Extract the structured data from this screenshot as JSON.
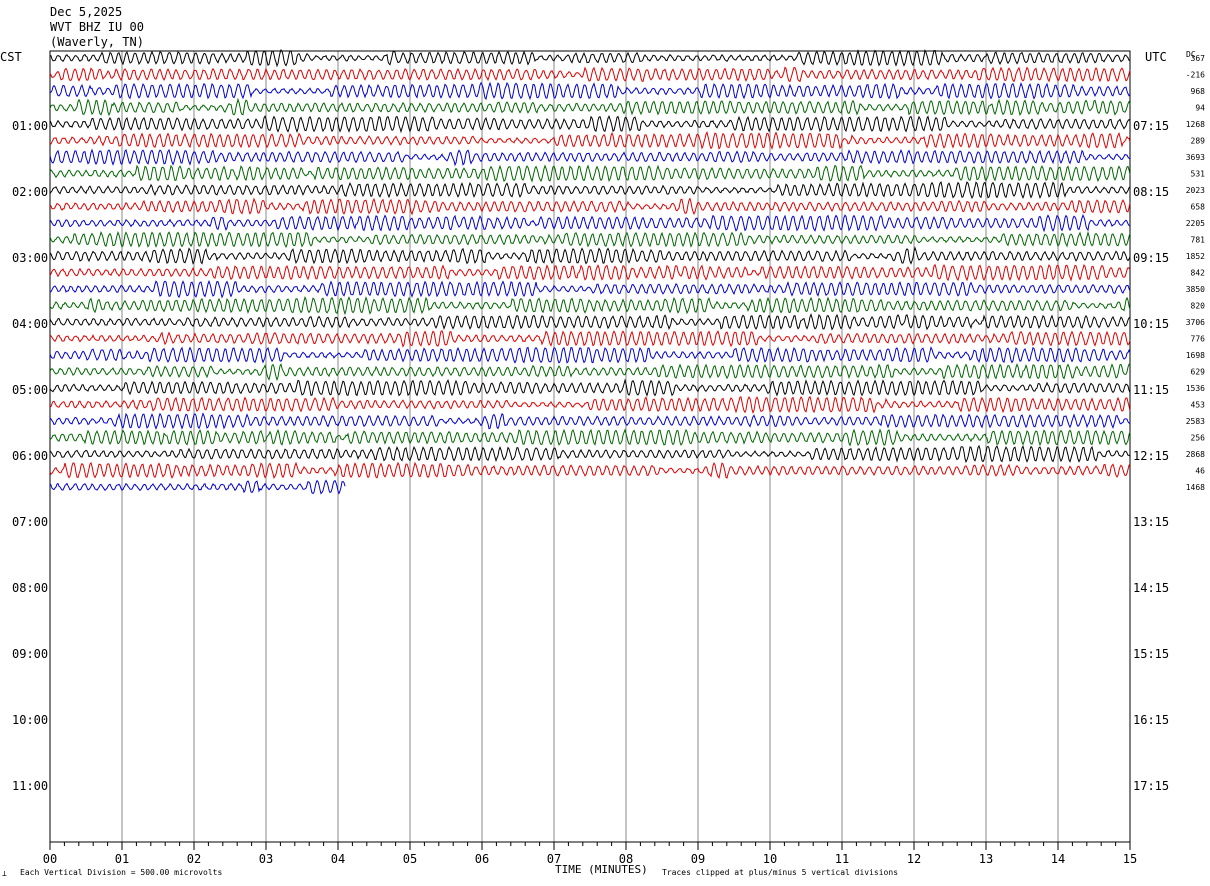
{
  "header": {
    "date": "Dec 5,2025",
    "station": "WVT BHZ IU 00",
    "location": "(Waverly, TN)"
  },
  "labels": {
    "left_tz": "CST",
    "right_tz": "UTC",
    "dc": "DC",
    "xlabel": "TIME (MINUTES)",
    "scale_note": "Each Vertical Division =  500.00 microvolts",
    "clip_note": "Traces clipped at plus/minus 5 vertical divisions"
  },
  "colors": {
    "trace_cycle": [
      "#000000",
      "#dd0000",
      "#0000cc",
      "#006600"
    ],
    "grid": "#888888"
  },
  "chart_data": {
    "type": "line",
    "title": "WVT BHZ IU 00",
    "xlabel": "TIME (MINUTES)",
    "xlim": [
      0,
      15
    ],
    "x_ticks": [
      "00",
      "01",
      "02",
      "03",
      "04",
      "05",
      "06",
      "07",
      "08",
      "09",
      "10",
      "11",
      "12",
      "13",
      "14",
      "15"
    ],
    "left_hour_labels": [
      "01:00",
      "02:00",
      "03:00",
      "04:00",
      "05:00",
      "06:00",
      "07:00",
      "08:00",
      "09:00",
      "10:00",
      "11:00"
    ],
    "right_hour_labels": [
      "07:15",
      "08:15",
      "09:15",
      "10:15",
      "11:15",
      "12:15",
      "13:15",
      "14:15",
      "15:15",
      "16:15",
      "17:15"
    ],
    "rows_per_hour": 4,
    "row_minutes": 15,
    "dc_offsets": [
      "367",
      "-216",
      "968",
      "94",
      "1268",
      "289",
      "3693",
      "531",
      "2023",
      "658",
      "2205",
      "781",
      "1852",
      "842",
      "3850",
      "820",
      "3706",
      "776",
      "1698",
      "629",
      "1536",
      "453",
      "2583",
      "256",
      "2868",
      "46",
      "1468"
    ],
    "rows_recorded": 27,
    "last_row_end_minute": 4.1,
    "scale_microvolts_per_division": 500.0,
    "clip_divisions": 5
  }
}
